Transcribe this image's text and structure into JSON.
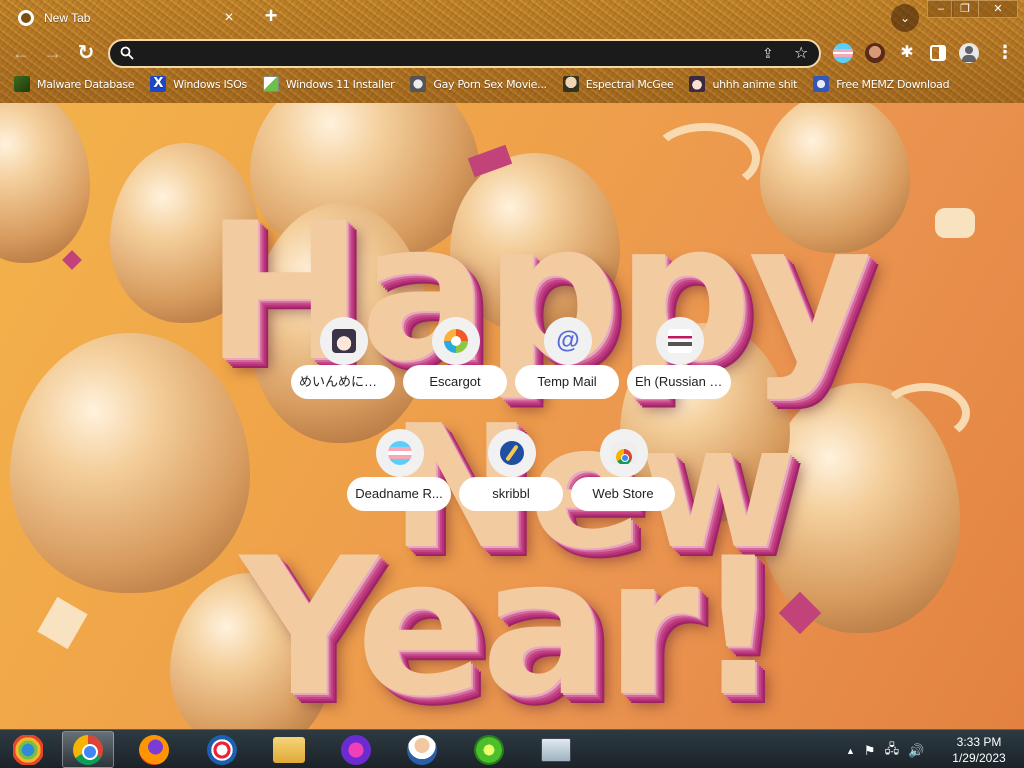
{
  "tab": {
    "title": "New Tab",
    "close_glyph": "×",
    "icon": "globe-icon"
  },
  "tabstrip": {
    "new_tab_glyph": "+",
    "tab_search_glyph": "⌄"
  },
  "window_controls": {
    "minimize": "–",
    "maximize": "❐",
    "close": "✕"
  },
  "toolbar": {
    "back_glyph": "←",
    "forward_glyph": "→",
    "reload_glyph": "↻",
    "menu_glyph": "⋮"
  },
  "omnibox": {
    "value": "",
    "placeholder": "",
    "share_glyph": "⇪",
    "star_glyph": "☆"
  },
  "extensions": [
    "trans-flag-icon",
    "avatar-face-icon",
    "puzzle-icon",
    "side-panel-icon",
    "profile-icon"
  ],
  "bookmarks": [
    {
      "label": "Malware Database",
      "icon": "malware-icon"
    },
    {
      "label": "Windows ISOs",
      "icon": "x-logo-icon"
    },
    {
      "label": "Windows 11 Installer",
      "icon": "windows-installer-icon"
    },
    {
      "label": "Gay Porn Sex Movie...",
      "icon": "site-icon"
    },
    {
      "label": "Espectral McGee",
      "icon": "avatar-icon"
    },
    {
      "label": "uhhh anime shit",
      "icon": "anime-icon"
    },
    {
      "label": "Free MEMZ Download",
      "icon": "memz-icon"
    }
  ],
  "shortcuts": [
    {
      "label": "めいんめにゅ...",
      "icon": "anime-avatar-icon"
    },
    {
      "label": "Escargot",
      "icon": "escargot-icon"
    },
    {
      "label": "Temp Mail",
      "icon": "at-sign-icon"
    },
    {
      "label": "Eh (Russian g...",
      "icon": "flag-icon"
    },
    {
      "label": "Deadname R...",
      "icon": "trans-flag-icon"
    },
    {
      "label": "skribbl",
      "icon": "skribbl-icon"
    },
    {
      "label": "Web Store",
      "icon": "webstore-icon"
    }
  ],
  "wallpaper": {
    "line1": "Happy",
    "line2": "New",
    "line3": "Year!"
  },
  "taskbar": {
    "items": [
      "start-orb-icon",
      "chrome-icon",
      "firefox-icon",
      "obama-logo-icon",
      "file-explorer-icon",
      "mask-app-icon",
      "doctor-app-icon",
      "lime-app-icon",
      "monitor-app-icon"
    ],
    "tray_up": "▲",
    "tray_flag": "⚑",
    "tray_network": "🖧",
    "tray_volume": "🔊",
    "time": "3:33 PM",
    "date": "1/29/2023"
  },
  "colors": {
    "chrome_bg": "#b97a26",
    "omnibox_bg": "#1b1b1b",
    "wallpaper_accent": "#c54486",
    "taskbar_bg": "#1a2328"
  }
}
